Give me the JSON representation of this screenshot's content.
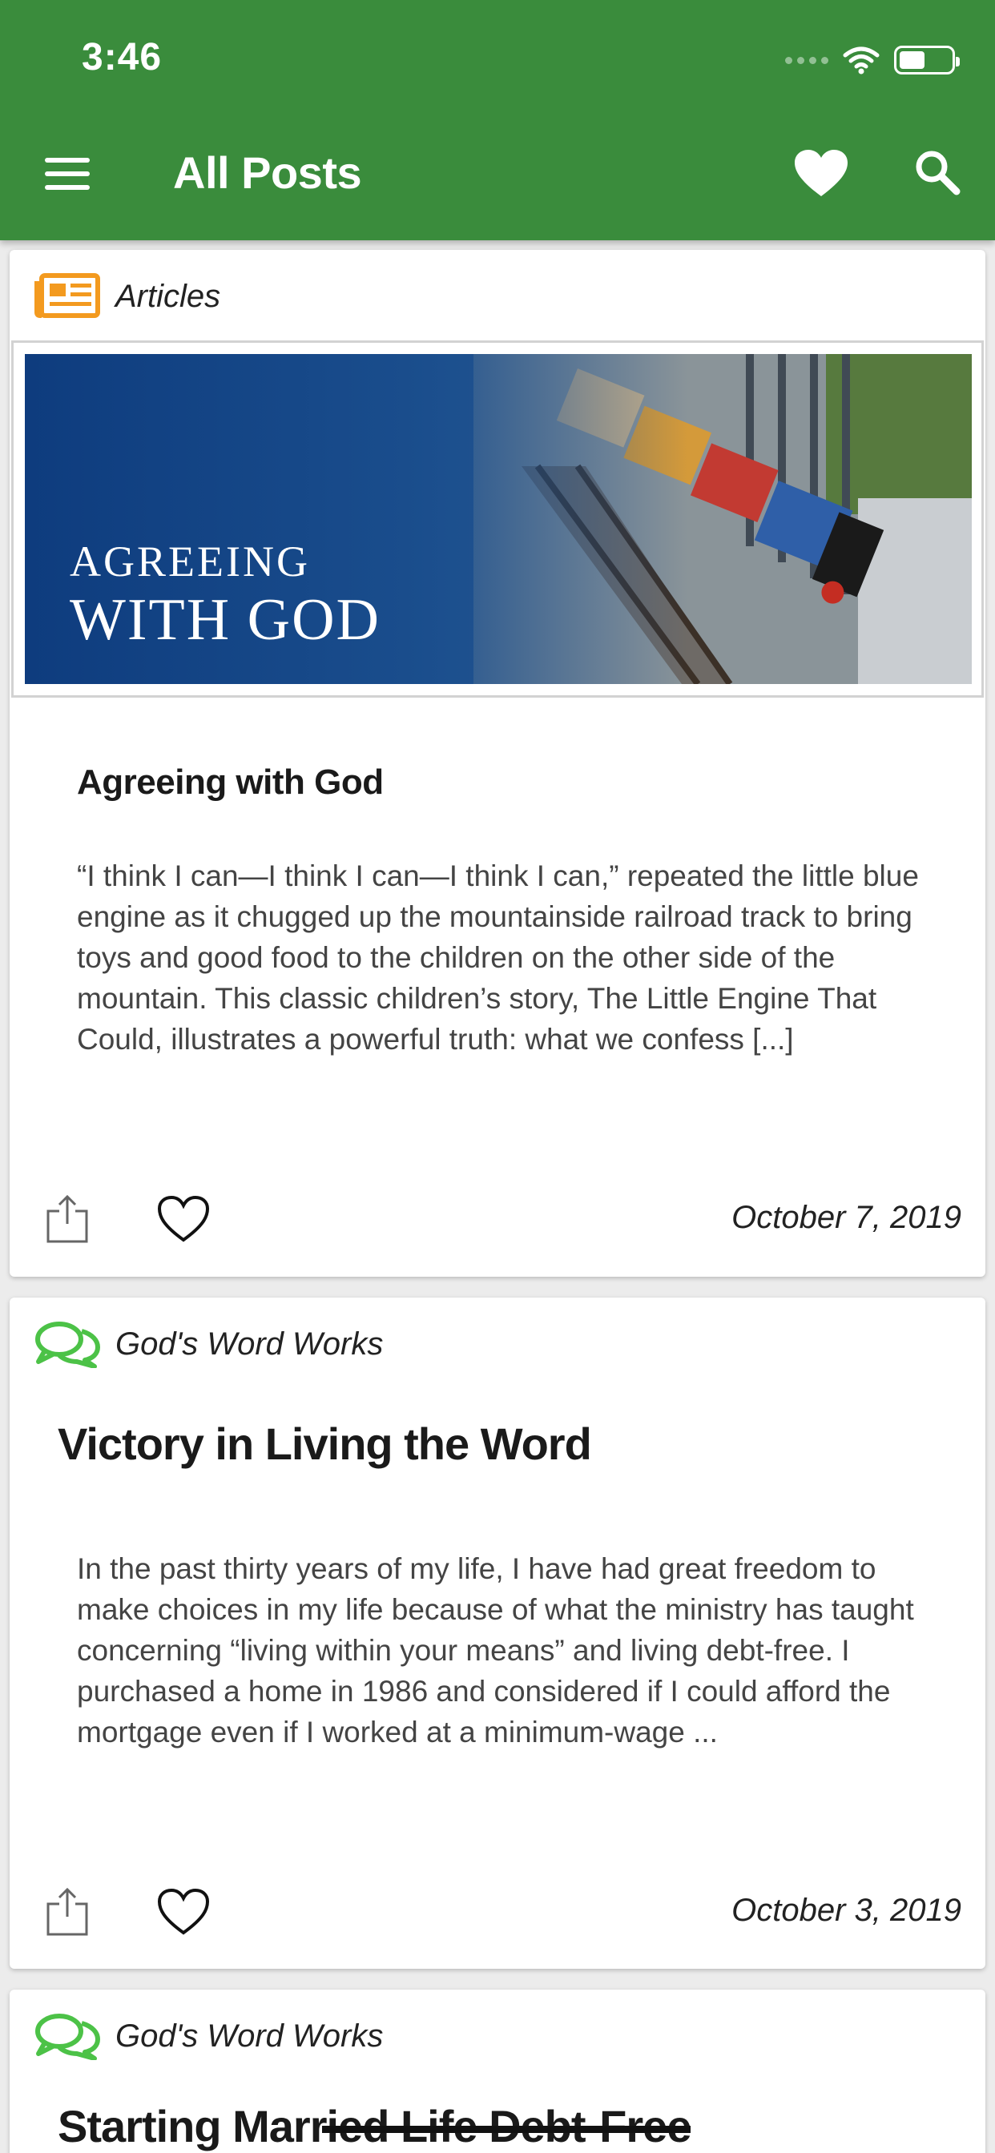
{
  "status_bar": {
    "time": "3:46"
  },
  "header": {
    "title": "All Posts",
    "menu_icon": "hamburger-menu-icon",
    "favorites_icon": "heart-filled-icon",
    "search_icon": "search-icon",
    "background_color": "#3a8c3c"
  },
  "posts": [
    {
      "category": "Articles",
      "category_icon": "newspaper-icon",
      "category_icon_color": "#f39a1f",
      "banner": {
        "line1": "AGREEING",
        "line2": "WITH GOD"
      },
      "title": "Agreeing with God",
      "excerpt": "“I think I can—I think I can—I think I can,” repeated the little blue engine as it chugged up the mountainside railroad track to bring toys and good food to the children on the other side of the mountain. This classic children’s story, The Little Engine That Could, illustrates a powerful truth: what we confess [...]",
      "date": "October 7, 2019"
    },
    {
      "category": "God's Word Works",
      "category_icon": "chat-bubbles-icon",
      "category_icon_color": "#4cc247",
      "title": "Victory in Living the Word",
      "excerpt": "In the past thirty years of my life, I have had great freedom to make choices in my life because of what the ministry has taught concerning “living within your means” and living debt-free. I purchased a home in 1986 and considered if I could afford the mortgage even if I worked at a minimum-wage ...",
      "date": "October 3, 2019"
    },
    {
      "category": "God's Word Works",
      "category_icon": "chat-bubbles-icon",
      "category_icon_color": "#4cc247",
      "title": "Starting Married Life Debt-Free"
    }
  ]
}
